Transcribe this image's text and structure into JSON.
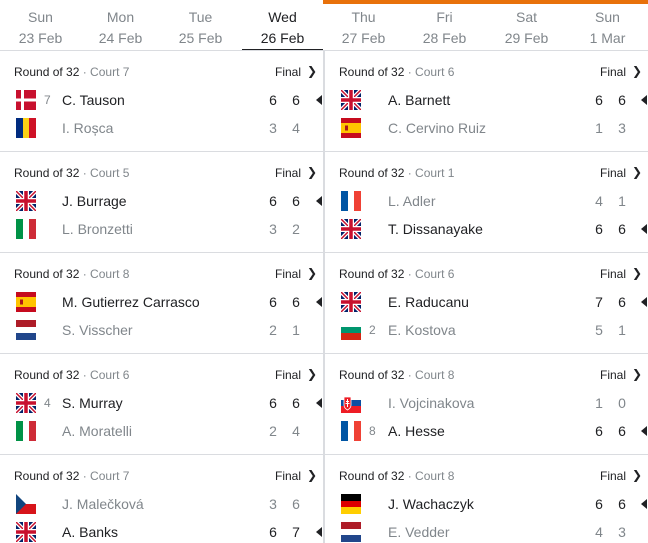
{
  "days": [
    {
      "name": "Sun",
      "date": "23 Feb",
      "selected": false
    },
    {
      "name": "Mon",
      "date": "24 Feb",
      "selected": false
    },
    {
      "name": "Tue",
      "date": "25 Feb",
      "selected": false
    },
    {
      "name": "Wed",
      "date": "26 Feb",
      "selected": true
    },
    {
      "name": "Thu",
      "date": "27 Feb",
      "selected": false
    },
    {
      "name": "Fri",
      "date": "28 Feb",
      "selected": false
    },
    {
      "name": "Sat",
      "date": "29 Feb",
      "selected": false
    },
    {
      "name": "Sun",
      "date": "1 Mar",
      "selected": false
    }
  ],
  "accent_color": "#e8710a",
  "left_matches": [
    {
      "round": "Round of 32",
      "court": " · Court 7",
      "status": "Final",
      "p1": {
        "name": "C. Tauson",
        "seed": "7",
        "flag": "denmark",
        "s1": "6",
        "s2": "6",
        "winner": true
      },
      "p2": {
        "name": "I. Roșca",
        "seed": "",
        "flag": "romania",
        "s1": "3",
        "s2": "4",
        "winner": false
      }
    },
    {
      "round": "Round of 32",
      "court": " · Court 5",
      "status": "Final",
      "p1": {
        "name": "J. Burrage",
        "seed": "",
        "flag": "uk",
        "s1": "6",
        "s2": "6",
        "winner": true
      },
      "p2": {
        "name": "L. Bronzetti",
        "seed": "",
        "flag": "italy",
        "s1": "3",
        "s2": "2",
        "winner": false
      }
    },
    {
      "round": "Round of 32",
      "court": " · Court 8",
      "status": "Final",
      "p1": {
        "name": "M. Gutierrez Carrasco",
        "seed": "",
        "flag": "spain",
        "s1": "6",
        "s2": "6",
        "winner": true
      },
      "p2": {
        "name": "S. Visscher",
        "seed": "",
        "flag": "netherlands",
        "s1": "2",
        "s2": "1",
        "winner": false
      }
    },
    {
      "round": "Round of 32",
      "court": " · Court 6",
      "status": "Final",
      "p1": {
        "name": "S. Murray",
        "seed": "4",
        "flag": "uk",
        "s1": "6",
        "s2": "6",
        "winner": true
      },
      "p2": {
        "name": "A. Moratelli",
        "seed": "",
        "flag": "italy",
        "s1": "2",
        "s2": "4",
        "winner": false
      }
    },
    {
      "round": "Round of 32",
      "court": " · Court 7",
      "status": "Final",
      "p1": {
        "name": "J. Malečková",
        "seed": "",
        "flag": "czech",
        "s1": "3",
        "s2": "6",
        "winner": false
      },
      "p2": {
        "name": "A. Banks",
        "seed": "",
        "flag": "uk",
        "s1": "6",
        "s2": "7",
        "winner": true
      }
    }
  ],
  "right_matches": [
    {
      "round": "Round of 32",
      "court": " · Court 6",
      "status": "Final",
      "p1": {
        "name": "A. Barnett",
        "seed": "",
        "flag": "uk",
        "s1": "6",
        "s2": "6",
        "winner": true
      },
      "p2": {
        "name": "C. Cervino Ruiz",
        "seed": "",
        "flag": "spain",
        "s1": "1",
        "s2": "3",
        "winner": false
      }
    },
    {
      "round": "Round of 32",
      "court": " · Court 1",
      "status": "Final",
      "p1": {
        "name": "L. Adler",
        "seed": "",
        "flag": "france",
        "s1": "4",
        "s2": "1",
        "winner": false
      },
      "p2": {
        "name": "T. Dissanayake",
        "seed": "",
        "flag": "uk",
        "s1": "6",
        "s2": "6",
        "winner": true
      }
    },
    {
      "round": "Round of 32",
      "court": " · Court 6",
      "status": "Final",
      "p1": {
        "name": "E. Raducanu",
        "seed": "",
        "flag": "uk",
        "s1": "7",
        "s2": "6",
        "winner": true
      },
      "p2": {
        "name": "E. Kostova",
        "seed": "2",
        "flag": "bulgaria",
        "s1": "5",
        "s2": "1",
        "winner": false
      }
    },
    {
      "round": "Round of 32",
      "court": " · Court 8",
      "status": "Final",
      "p1": {
        "name": "I. Vojcinakova",
        "seed": "",
        "flag": "slovakia",
        "s1": "1",
        "s2": "0",
        "winner": false
      },
      "p2": {
        "name": "A. Hesse",
        "seed": "8",
        "flag": "france",
        "s1": "6",
        "s2": "6",
        "winner": true
      }
    },
    {
      "round": "Round of 32",
      "court": " · Court 8",
      "status": "Final",
      "p1": {
        "name": "J. Wachaczyk",
        "seed": "",
        "flag": "germany",
        "s1": "6",
        "s2": "6",
        "winner": true
      },
      "p2": {
        "name": "E. Vedder",
        "seed": "",
        "flag": "netherlands",
        "s1": "4",
        "s2": "3",
        "winner": false
      }
    }
  ]
}
